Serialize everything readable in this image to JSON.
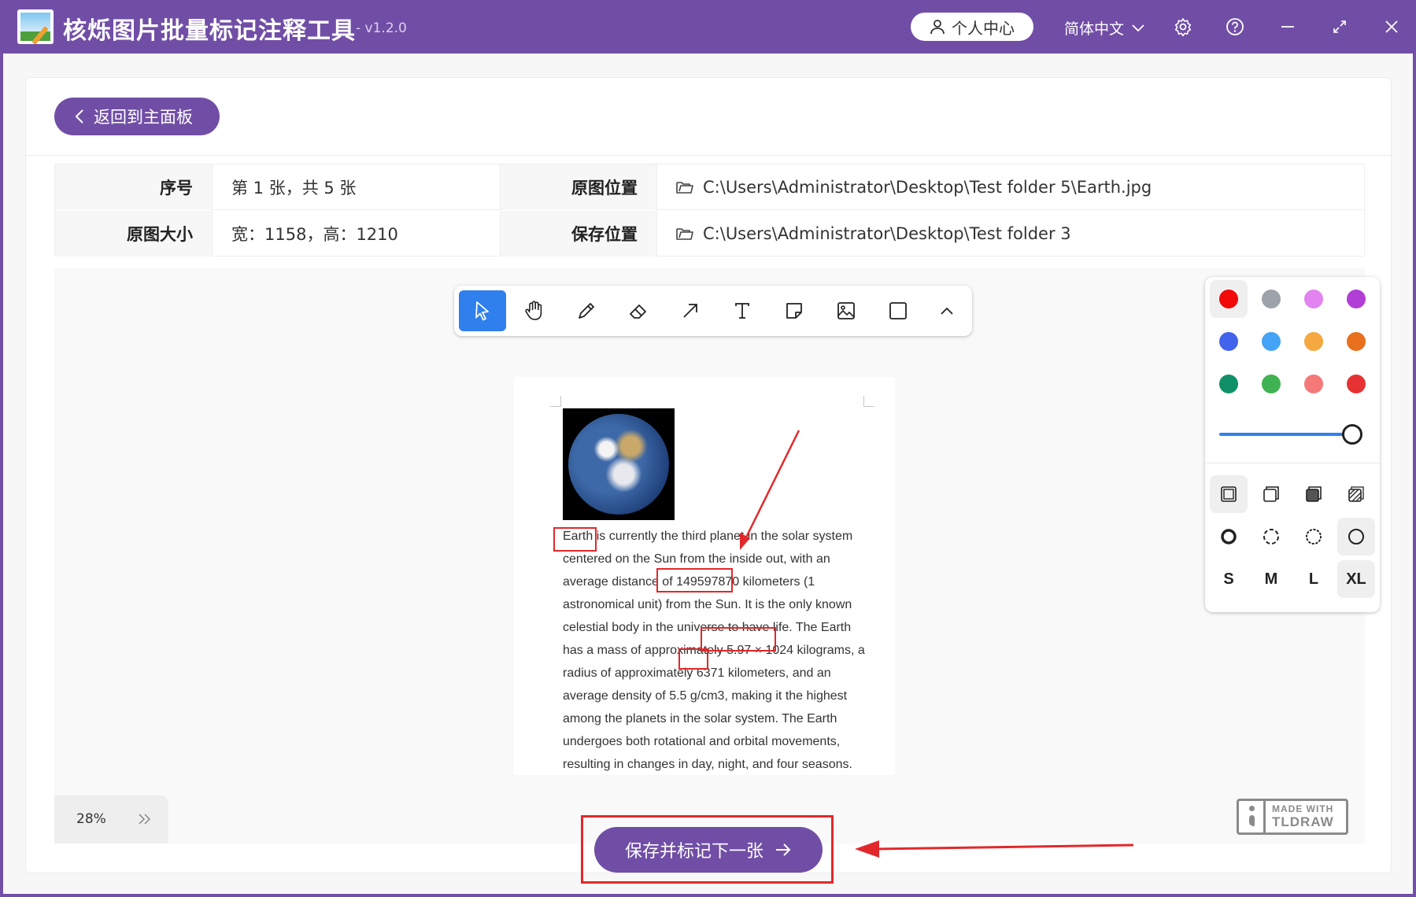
{
  "app": {
    "title": "核烁图片批量标记注释工具",
    "version": "- v1.2.0",
    "user_center": "个人中心",
    "language": "简体中文"
  },
  "nav": {
    "back_label": "返回到主面板"
  },
  "info": {
    "index_label": "序号",
    "index_value": "第 1 张，共 5 张",
    "size_label": "原图大小",
    "size_value": "宽：1158，高：1210",
    "source_label": "原图位置",
    "source_path": "C:\\Users\\Administrator\\Desktop\\Test folder 5\\Earth.jpg",
    "save_label": "保存位置",
    "save_path": "C:\\Users\\Administrator\\Desktop\\Test folder 3"
  },
  "tools": [
    "select-icon",
    "hand-icon",
    "pencil-icon",
    "eraser-icon",
    "arrow-icon",
    "text-icon",
    "note-icon",
    "image-icon",
    "rectangle-icon",
    "chevron-up-icon"
  ],
  "document": {
    "lines": [
      "Earth is currently the third planet in the solar system",
      "centered on the Sun from the inside out, with an",
      "average distance of 149597870 kilometers (1",
      "astronomical unit) from the Sun. It is the only known",
      "celestial body in the universe to have life. The Earth",
      "has a mass of approximately 5.97 × 1024 kilograms, a",
      "radius of approximately 6371 kilometers, and an",
      "average density of 5.5 g/cm3, making it the highest",
      "among the planets in the solar system. The Earth",
      "undergoes both rotational and orbital movements,",
      "resulting in changes in day, night, and four seasons."
    ],
    "highlighted_terms": [
      "Earth",
      "149597870",
      "5.97 × 1024",
      "6371"
    ],
    "annotation_color": "#e2282a"
  },
  "style_panel": {
    "colors": [
      "#f00a0a",
      "#9ea3ab",
      "#e184f0",
      "#b13fd6",
      "#4263eb",
      "#44a3f5",
      "#f5a840",
      "#e8701e",
      "#109066",
      "#3fb352",
      "#f67979",
      "#e63232"
    ],
    "selected_color": "#f00a0a",
    "size_options": [
      "S",
      "M",
      "L",
      "XL"
    ],
    "selected_size": "XL"
  },
  "zoom": {
    "level": "28%"
  },
  "watermark": {
    "line1": "MADE WITH",
    "line2": "TLDRAW"
  },
  "actions": {
    "next_label": "保存并标记下一张"
  },
  "theme": {
    "accent": "#714ea6",
    "tool_active": "#2f80ed"
  }
}
